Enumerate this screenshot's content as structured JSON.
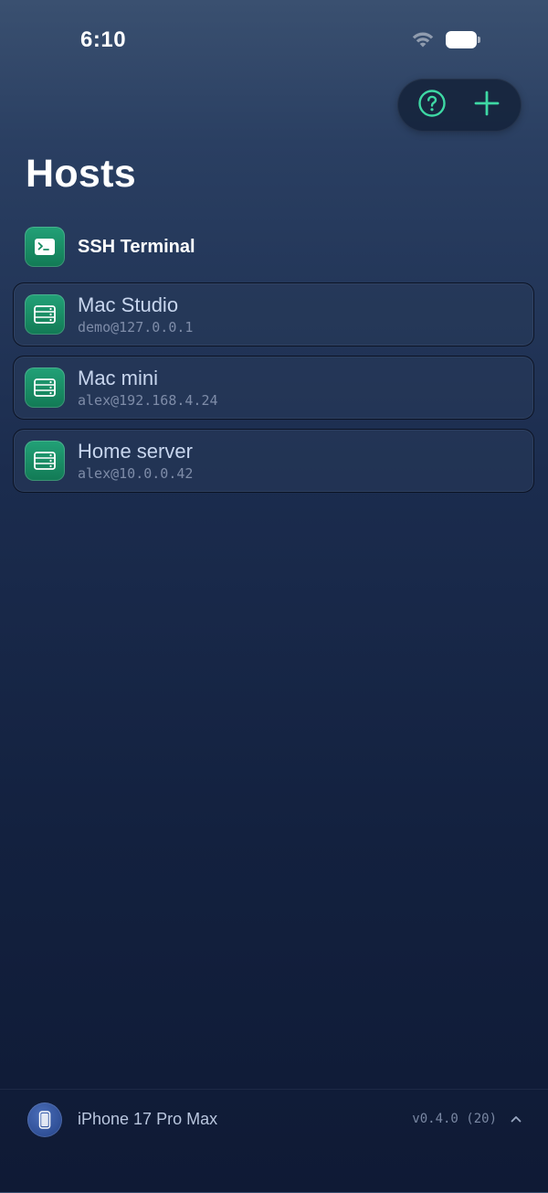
{
  "status_bar": {
    "time": "6:10"
  },
  "toolbar": {
    "help_icon": "question-circle",
    "add_icon": "plus",
    "accent_color": "#3ed8a4"
  },
  "page": {
    "title": "Hosts"
  },
  "terminal_entry": {
    "label": "SSH Terminal",
    "icon": "terminal"
  },
  "hosts": [
    {
      "name": "Mac Studio",
      "address": "demo@127.0.0.1",
      "icon": "server"
    },
    {
      "name": "Mac mini",
      "address": "alex@192.168.4.24",
      "icon": "server"
    },
    {
      "name": "Home server",
      "address": "alex@10.0.0.42",
      "icon": "server"
    }
  ],
  "footer": {
    "device_name": "iPhone 17 Pro Max",
    "version": "v0.4.0 (20)",
    "device_icon": "iphone",
    "expand_icon": "chevron-up"
  },
  "colors": {
    "icon_green": "#1a8c64",
    "accent": "#3ed8a4"
  }
}
